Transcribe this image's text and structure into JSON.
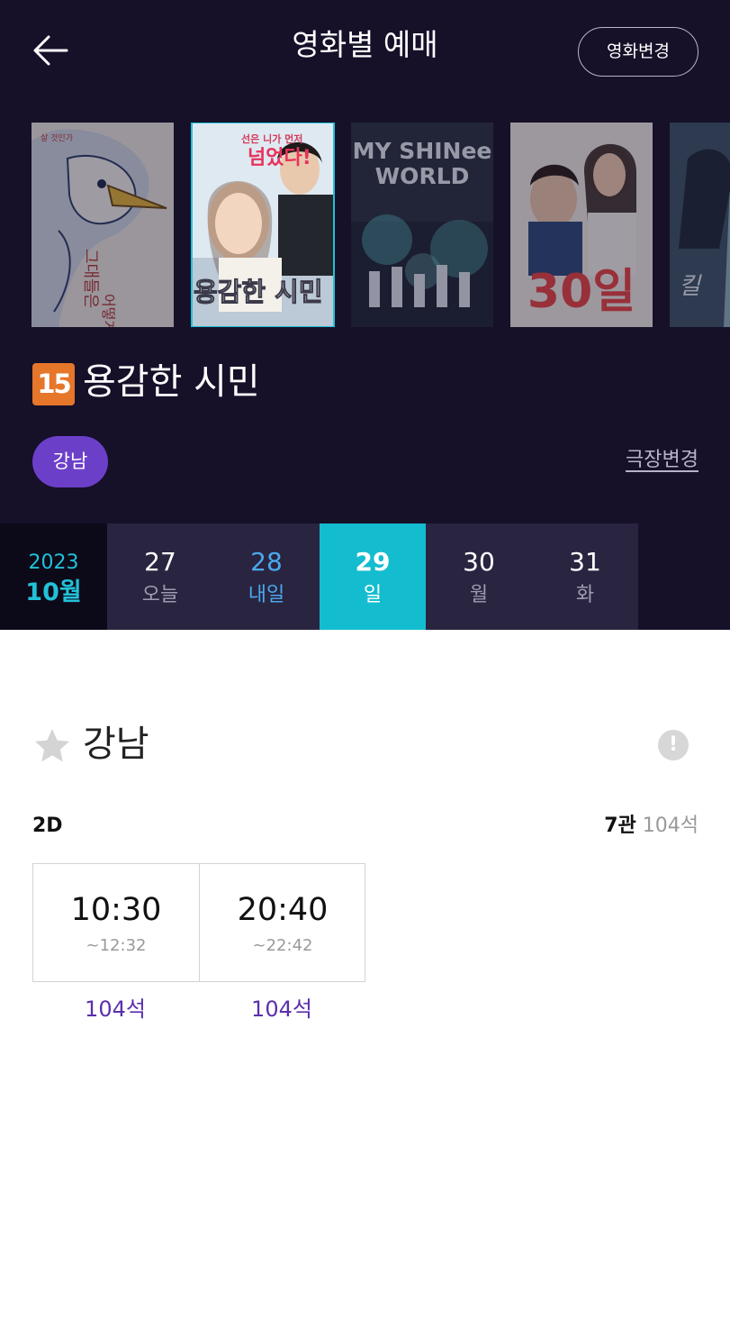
{
  "header": {
    "title": "영화별 예매",
    "change_movie_label": "영화변경"
  },
  "posters": [
    {
      "name": "poster-1",
      "texts": [
        "그대들은",
        "어떻게",
        "살 것인가"
      ],
      "selected": false
    },
    {
      "name": "poster-2",
      "texts": [
        "선은 니가 먼저",
        "넘었다!",
        "용감한 시민"
      ],
      "selected": true
    },
    {
      "name": "poster-3",
      "texts": [
        "MY SHINee",
        "WORLD"
      ],
      "selected": false
    },
    {
      "name": "poster-4",
      "texts": [
        "30일"
      ],
      "selected": false
    },
    {
      "name": "poster-5",
      "texts": [
        "킬"
      ],
      "selected": false
    }
  ],
  "movie": {
    "rating": "15",
    "title": "용감한 시민"
  },
  "theater": {
    "chip_label": "강남",
    "change_label": "극장변경"
  },
  "dates": {
    "year": "2023",
    "month": "10월",
    "days": [
      {
        "num": "27",
        "label": "오늘"
      },
      {
        "num": "28",
        "label": "내일"
      },
      {
        "num": "29",
        "label": "일"
      },
      {
        "num": "30",
        "label": "월"
      },
      {
        "num": "31",
        "label": "화"
      }
    ]
  },
  "schedule": {
    "theater_name": "강남",
    "format": "2D",
    "hall": "7관",
    "total_seats": "104석",
    "showtimes": [
      {
        "start": "10:30",
        "end": "~12:32",
        "seats": "104석"
      },
      {
        "start": "20:40",
        "end": "~22:42",
        "seats": "104석"
      }
    ]
  },
  "colors": {
    "header_bg": "#161029",
    "accent_cyan": "#14bccf",
    "chip_purple": "#6c3fc9",
    "rating_orange": "#e5762a",
    "seat_purple": "#5b2fae"
  },
  "icons": {
    "back": "arrow-left-icon",
    "favorite": "star-icon",
    "info": "exclamation-circle-icon"
  }
}
